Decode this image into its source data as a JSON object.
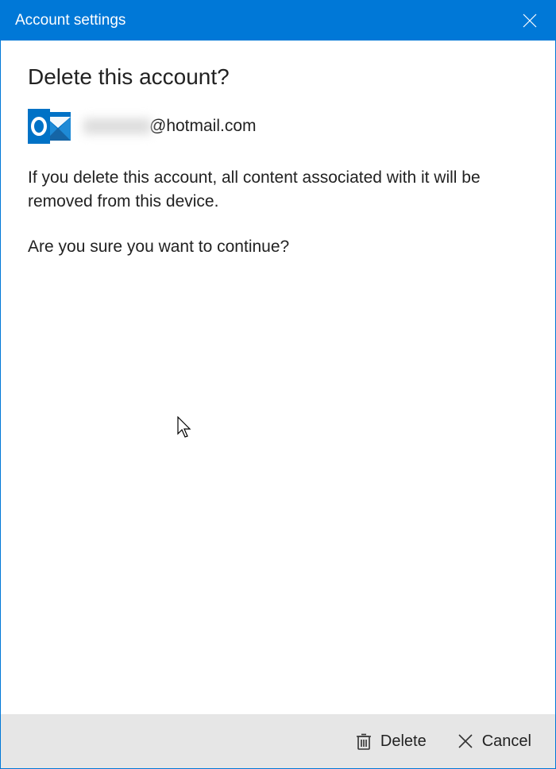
{
  "titlebar": {
    "title": "Account settings"
  },
  "main": {
    "heading": "Delete this account?",
    "email_domain": "@hotmail.com",
    "warning": "If you delete this account, all content associated with it will be removed from this device.",
    "confirm": "Are you sure you want to continue?"
  },
  "footer": {
    "delete_label": "Delete",
    "cancel_label": "Cancel"
  }
}
